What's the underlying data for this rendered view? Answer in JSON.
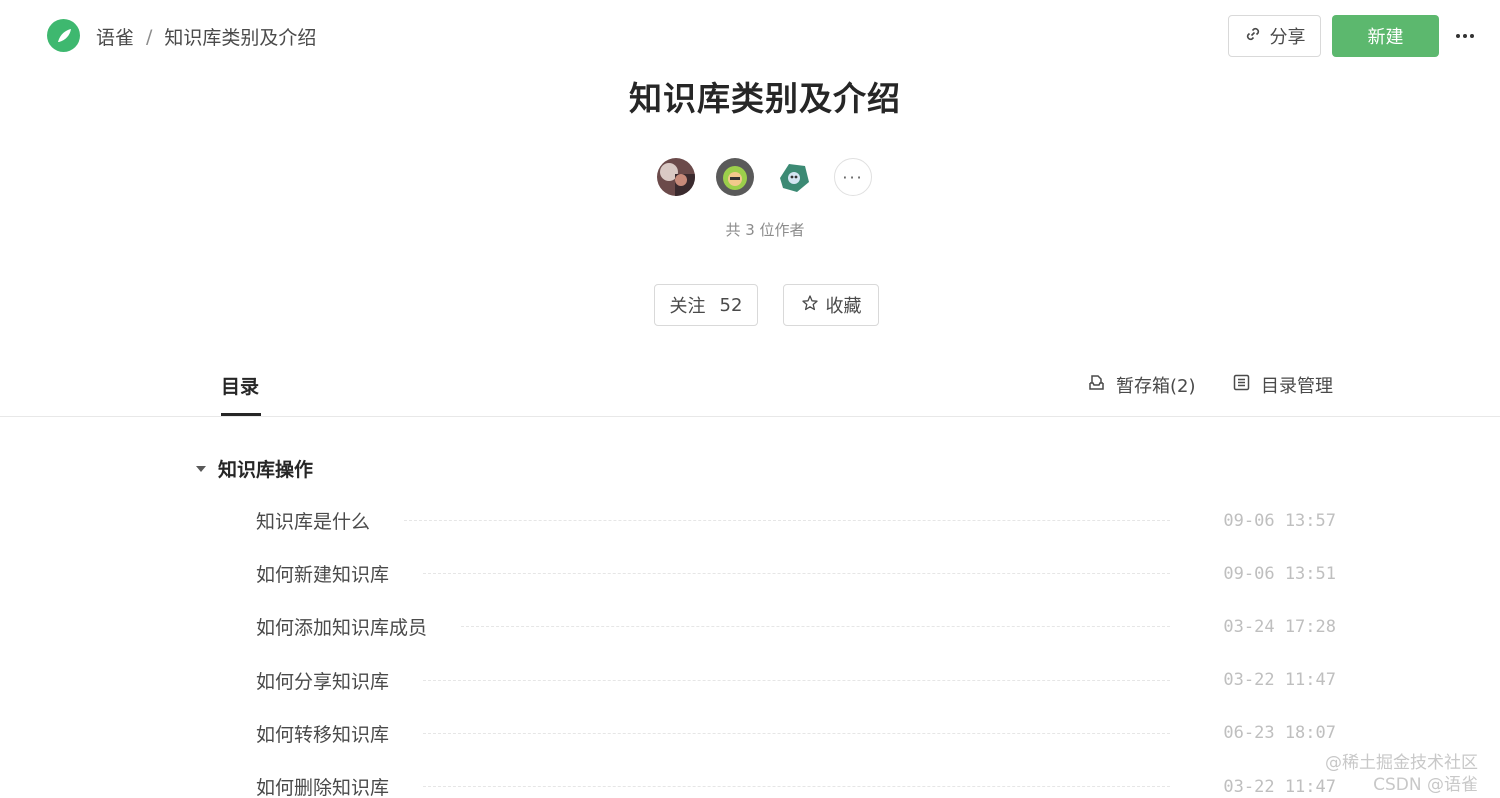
{
  "header": {
    "app_name": "语雀",
    "separator": "/",
    "current_book": "知识库类别及介绍",
    "share_label": "分享",
    "new_label": "新建",
    "brand_color": "#5cb86e"
  },
  "book": {
    "title": "知识库类别及介绍",
    "authors_count_text": "共 3 位作者",
    "follow_label": "关注",
    "follow_count": "52",
    "favorite_label": "收藏"
  },
  "tabs": {
    "active_label": "目录",
    "drafts_label": "暂存箱(2)",
    "manage_label": "目录管理"
  },
  "catalog": {
    "group_title": "知识库操作",
    "docs": [
      {
        "title": "知识库是什么",
        "time": "09-06 13:57"
      },
      {
        "title": "如何新建知识库",
        "time": "09-06 13:51"
      },
      {
        "title": "如何添加知识库成员",
        "time": "03-24 17:28"
      },
      {
        "title": "如何分享知识库",
        "time": "03-22 11:47"
      },
      {
        "title": "如何转移知识库",
        "time": "06-23 18:07"
      },
      {
        "title": "如何删除知识库",
        "time": "03-22 11:47"
      }
    ]
  },
  "watermark": {
    "line1": "@稀土掘金技术社区",
    "line2": "CSDN @语雀"
  }
}
